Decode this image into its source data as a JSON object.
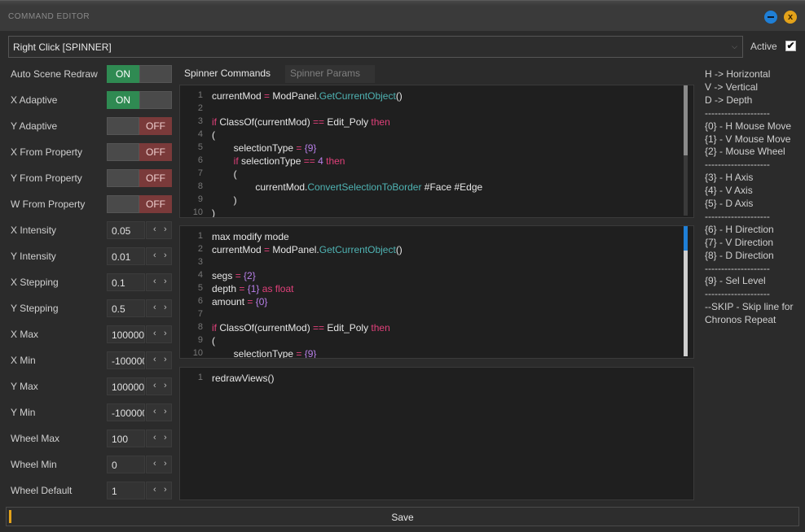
{
  "window": {
    "title": "COMMAND EDITOR",
    "minimize_glyph": "",
    "close_glyph": "x"
  },
  "combo": {
    "value": "Right Click [SPINNER]"
  },
  "active": {
    "label": "Active",
    "checked": "✔"
  },
  "toggles": [
    {
      "label": "Auto Scene Redraw",
      "on": "ON",
      "off": "OFF",
      "state": "on"
    },
    {
      "label": "X Adaptive",
      "on": "ON",
      "off": "OFF",
      "state": "on"
    },
    {
      "label": "Y Adaptive",
      "on": "ON",
      "off": "OFF",
      "state": "off"
    },
    {
      "label": "X From Property",
      "on": "ON",
      "off": "OFF",
      "state": "off"
    },
    {
      "label": "Y From Property",
      "on": "ON",
      "off": "OFF",
      "state": "off"
    },
    {
      "label": "W From Property",
      "on": "ON",
      "off": "OFF",
      "state": "off"
    }
  ],
  "spinners": [
    {
      "label": "X Intensity",
      "value": "0.05"
    },
    {
      "label": "Y Intensity",
      "value": "0.01"
    },
    {
      "label": "X Stepping",
      "value": "0.1"
    },
    {
      "label": "Y Stepping",
      "value": "0.5"
    },
    {
      "label": "X Max",
      "value": "100000"
    },
    {
      "label": "X Min",
      "value": "-100000"
    },
    {
      "label": "Y Max",
      "value": "100000"
    },
    {
      "label": "Y Min",
      "value": "-100000"
    },
    {
      "label": "Wheel Max",
      "value": "100"
    },
    {
      "label": "Wheel Min",
      "value": "0"
    },
    {
      "label": "Wheel Default",
      "value": "1"
    }
  ],
  "spin_buttons": {
    "left": "‹",
    "right": "›"
  },
  "tabs": [
    {
      "label": "Spinner Commands"
    },
    {
      "label": "Spinner Params"
    }
  ],
  "editor1": [
    {
      "n": "1",
      "code": "currentMod = ModPanel.GetCurrentObject()"
    },
    {
      "n": "2",
      "code": ""
    },
    {
      "n": "3",
      "code": "if ClassOf(currentMod) == Edit_Poly then"
    },
    {
      "n": "4",
      "code": "("
    },
    {
      "n": "5",
      "code": "        selectionType = {9}"
    },
    {
      "n": "6",
      "code": "        if selectionType == 4 then"
    },
    {
      "n": "7",
      "code": "        ("
    },
    {
      "n": "8",
      "code": "                currentMod.ConvertSelectionToBorder #Face #Edge"
    },
    {
      "n": "9",
      "code": "        )"
    },
    {
      "n": "10",
      "code": ")"
    }
  ],
  "editor2": [
    {
      "n": "1",
      "code": "max modify mode"
    },
    {
      "n": "2",
      "code": "currentMod = ModPanel.GetCurrentObject()"
    },
    {
      "n": "3",
      "code": ""
    },
    {
      "n": "4",
      "code": "segs = {2}"
    },
    {
      "n": "5",
      "code": "depth = {1} as float"
    },
    {
      "n": "6",
      "code": "amount = {0}"
    },
    {
      "n": "7",
      "code": ""
    },
    {
      "n": "8",
      "code": "if ClassOf(currentMod) == Edit_Poly then"
    },
    {
      "n": "9",
      "code": "("
    },
    {
      "n": "10",
      "code": "        selectionType = {9}"
    }
  ],
  "editor3": [
    {
      "n": "1",
      "code": "redrawViews()"
    }
  ],
  "legend": [
    "H -> Horizontal",
    "V -> Vertical",
    "D -> Depth",
    "--------------------",
    "{0} - H Mouse Move",
    "{1} - V Mouse Move",
    "{2} - Mouse Wheel",
    "--------------------",
    "{3} - H Axis",
    "{4} - V Axis",
    "{5} - D Axis",
    "--------------------",
    "{6} - H Direction",
    "{7} - V Direction",
    "{8} - D Direction",
    "--------------------",
    "{9} - Sel Level",
    "--------------------",
    "--SKIP - Skip line for",
    "Chronos Repeat"
  ],
  "save": {
    "label": "Save"
  },
  "colors": {
    "on": "#2f8a52",
    "off": "#7a3a3a",
    "accent": "#e3a21a",
    "keyword": "#e0407a",
    "function": "#4fb3b3",
    "number": "#b77fe8"
  }
}
